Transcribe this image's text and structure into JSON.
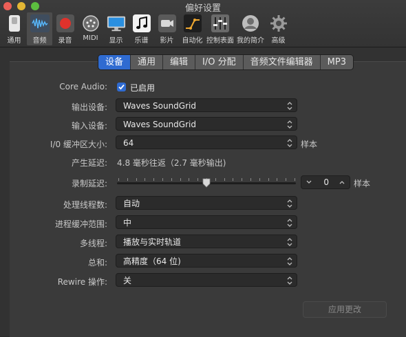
{
  "window": {
    "title": "偏好设置"
  },
  "toolbar": {
    "items": [
      {
        "label": "通用",
        "icon": "switch-icon"
      },
      {
        "label": "音频",
        "icon": "waveform-icon",
        "selected": true
      },
      {
        "label": "录音",
        "icon": "record-icon"
      },
      {
        "label": "MIDI",
        "icon": "midi-icon"
      },
      {
        "label": "显示",
        "icon": "display-icon"
      },
      {
        "label": "乐谱",
        "icon": "music-note-icon"
      },
      {
        "label": "影片",
        "icon": "film-camera-icon"
      },
      {
        "label": "自动化",
        "icon": "automation-curve-icon"
      },
      {
        "label": "控制表面",
        "icon": "control-surface-icon"
      },
      {
        "label": "我的简介",
        "icon": "profile-icon"
      },
      {
        "label": "高级",
        "icon": "gear-icon"
      }
    ]
  },
  "tabs": [
    {
      "label": "设备",
      "active": true
    },
    {
      "label": "通用"
    },
    {
      "label": "编辑"
    },
    {
      "label": "I/O 分配"
    },
    {
      "label": "音频文件编辑器"
    },
    {
      "label": "MP3"
    }
  ],
  "form": {
    "core_audio": {
      "label": "Core Audio:",
      "checkbox_label": "已启用",
      "checked": true
    },
    "output_device": {
      "label": "输出设备:",
      "value": "Waves SoundGrid"
    },
    "input_device": {
      "label": "输入设备:",
      "value": "Waves SoundGrid"
    },
    "io_buffer": {
      "label": "I/0 缓冲区大小:",
      "value": "64",
      "unit": "样本"
    },
    "latency": {
      "label": "产生延迟:",
      "value": "4.8 毫秒往返（2.7 毫秒输出)"
    },
    "record_delay": {
      "label": "录制延迟:",
      "value": "0",
      "unit": "样本",
      "slider_fraction": 0.5
    },
    "process_threads": {
      "label": "处理线程数:",
      "value": "自动"
    },
    "process_buffer_range": {
      "label": "进程缓冲范围:",
      "value": "中"
    },
    "multithreading": {
      "label": "多线程:",
      "value": "播放与实时轨道"
    },
    "summing": {
      "label": "总和:",
      "value": "高精度（64 位)"
    },
    "rewire": {
      "label": "Rewire 操作:",
      "value": "关"
    }
  },
  "apply_button": {
    "label": "应用更改",
    "enabled": false
  },
  "colors": {
    "accent": "#2f6bd1",
    "panel": "#3a3a3a",
    "control": "#2b2b2b"
  }
}
